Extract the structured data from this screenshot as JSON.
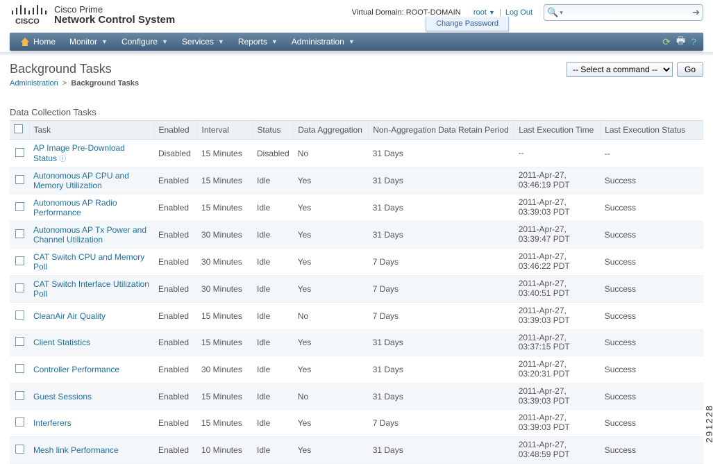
{
  "brand": {
    "line1": "Cisco Prime",
    "line2": "Network Control System"
  },
  "header": {
    "virtual_domain_label": "Virtual Domain:",
    "virtual_domain_value": "ROOT-DOMAIN",
    "user": "root",
    "logout": "Log Out",
    "dropdown_item": "Change Password"
  },
  "nav": {
    "items": [
      "Home",
      "Monitor",
      "Configure",
      "Services",
      "Reports",
      "Administration"
    ]
  },
  "page": {
    "title": "Background Tasks",
    "breadcrumb_parent": "Administration",
    "breadcrumb_sep": ">",
    "breadcrumb_current": "Background Tasks",
    "command_placeholder": "-- Select a command --",
    "go_label": "Go"
  },
  "section_title": "Data Collection Tasks",
  "columns": {
    "task": "Task",
    "enabled": "Enabled",
    "interval": "Interval",
    "status": "Status",
    "agg": "Data Aggregation",
    "retain": "Non-Aggregation Data Retain Period",
    "lastexec": "Last Execution Time",
    "laststatus": "Last Execution Status"
  },
  "rows": [
    {
      "task": "AP Image Pre-Download Status",
      "icon": true,
      "enabled": "Disabled",
      "interval": "15 Minutes",
      "status": "Disabled",
      "agg": "No",
      "retain": "31 Days",
      "time_a": "--",
      "time_b": "",
      "laststatus": "--"
    },
    {
      "task": "Autonomous AP CPU and Memory Utilization",
      "enabled": "Enabled",
      "interval": "15 Minutes",
      "status": "Idle",
      "agg": "Yes",
      "retain": "31 Days",
      "time_a": "2011-Apr-27,",
      "time_b": "03:46:19 PDT",
      "laststatus": "Success"
    },
    {
      "task": "Autonomous AP Radio Performance",
      "enabled": "Enabled",
      "interval": "15 Minutes",
      "status": "Idle",
      "agg": "Yes",
      "retain": "31 Days",
      "time_a": "2011-Apr-27,",
      "time_b": "03:39:03 PDT",
      "laststatus": "Success"
    },
    {
      "task": "Autonomous AP Tx Power and Channel Utilization",
      "enabled": "Enabled",
      "interval": "30 Minutes",
      "status": "Idle",
      "agg": "Yes",
      "retain": "31 Days",
      "time_a": "2011-Apr-27,",
      "time_b": "03:39:47 PDT",
      "laststatus": "Success"
    },
    {
      "task": "CAT Switch CPU and Memory Poll",
      "enabled": "Enabled",
      "interval": "30 Minutes",
      "status": "Idle",
      "agg": "Yes",
      "retain": "7 Days",
      "time_a": "2011-Apr-27,",
      "time_b": "03:46:22 PDT",
      "laststatus": "Success"
    },
    {
      "task": "CAT Switch Interface Utilization Poll",
      "enabled": "Enabled",
      "interval": "30 Minutes",
      "status": "Idle",
      "agg": "Yes",
      "retain": "7 Days",
      "time_a": "2011-Apr-27,",
      "time_b": "03:40:51 PDT",
      "laststatus": "Success"
    },
    {
      "task": "CleanAir Air Quality",
      "enabled": "Enabled",
      "interval": "15 Minutes",
      "status": "Idle",
      "agg": "No",
      "retain": "7 Days",
      "time_a": "2011-Apr-27,",
      "time_b": "03:39:03 PDT",
      "laststatus": "Success"
    },
    {
      "task": "Client Statistics",
      "enabled": "Enabled",
      "interval": "15 Minutes",
      "status": "Idle",
      "agg": "Yes",
      "retain": "31 Days",
      "time_a": "2011-Apr-27,",
      "time_b": "03:37:15 PDT",
      "laststatus": "Success"
    },
    {
      "task": "Controller Performance",
      "enabled": "Enabled",
      "interval": "30 Minutes",
      "status": "Idle",
      "agg": "Yes",
      "retain": "31 Days",
      "time_a": "2011-Apr-27,",
      "time_b": "03:20:31 PDT",
      "laststatus": "Success"
    },
    {
      "task": "Guest Sessions",
      "enabled": "Enabled",
      "interval": "15 Minutes",
      "status": "Idle",
      "agg": "No",
      "retain": "31 Days",
      "time_a": "2011-Apr-27,",
      "time_b": "03:39:03 PDT",
      "laststatus": "Success"
    },
    {
      "task": "Interferers",
      "enabled": "Enabled",
      "interval": "15 Minutes",
      "status": "Idle",
      "agg": "Yes",
      "retain": "7 Days",
      "time_a": "2011-Apr-27,",
      "time_b": "03:39:03 PDT",
      "laststatus": "Success"
    },
    {
      "task": "Mesh link Performance",
      "enabled": "Enabled",
      "interval": "10 Minutes",
      "status": "Idle",
      "agg": "Yes",
      "retain": "31 Days",
      "time_a": "2011-Apr-27,",
      "time_b": "03:48:59 PDT",
      "laststatus": "Success"
    }
  ],
  "side_code": "291228"
}
